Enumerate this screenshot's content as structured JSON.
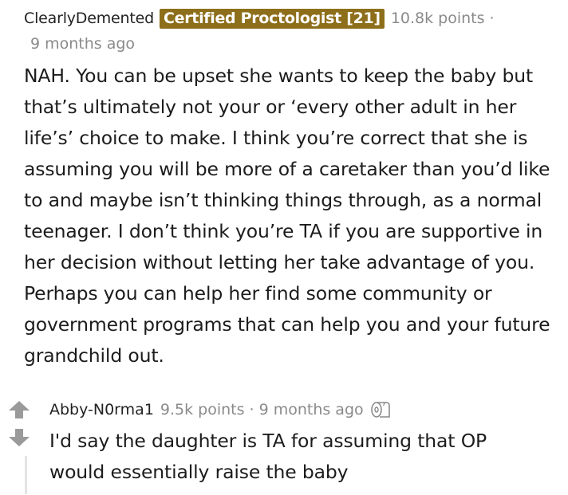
{
  "comment": {
    "username": "ClearlyDemented",
    "flair": "Certified Proctologist [21]",
    "points": "10.8k points",
    "separator": "·",
    "timestamp": "9 months ago",
    "body": "NAH. You can be upset she wants to keep the baby but that’s ultimately not your or ‘every other adult in her life’s’ choice to make. I think you’re correct that she is assuming you will be more of a caretaker than you’d like to and maybe isn’t thinking things through, as a normal teenager. I don’t think you’re TA if you are supportive in her decision without letting her take advantage of you. Perhaps you can help her find some community or government programs that can help you and your future grandchild out."
  },
  "reply": {
    "username": "Abby-N0rma1",
    "points": "9.5k points",
    "separator": "·",
    "timestamp": "9 months ago",
    "award_icon": "toilet-paper-icon",
    "body": "I'd say the daughter is TA for assuming that OP would essentially raise the baby"
  },
  "colors": {
    "flair_background": "#8d6e1a",
    "flair_text": "#ffffff",
    "muted_text": "#8a8a8a",
    "body_text": "#1c1c1c",
    "vote_arrow": "#9a9a9a",
    "thread_line": "#e4e4e4"
  },
  "icons": {
    "upvote": "upvote-arrow-icon",
    "downvote": "downvote-arrow-icon"
  }
}
